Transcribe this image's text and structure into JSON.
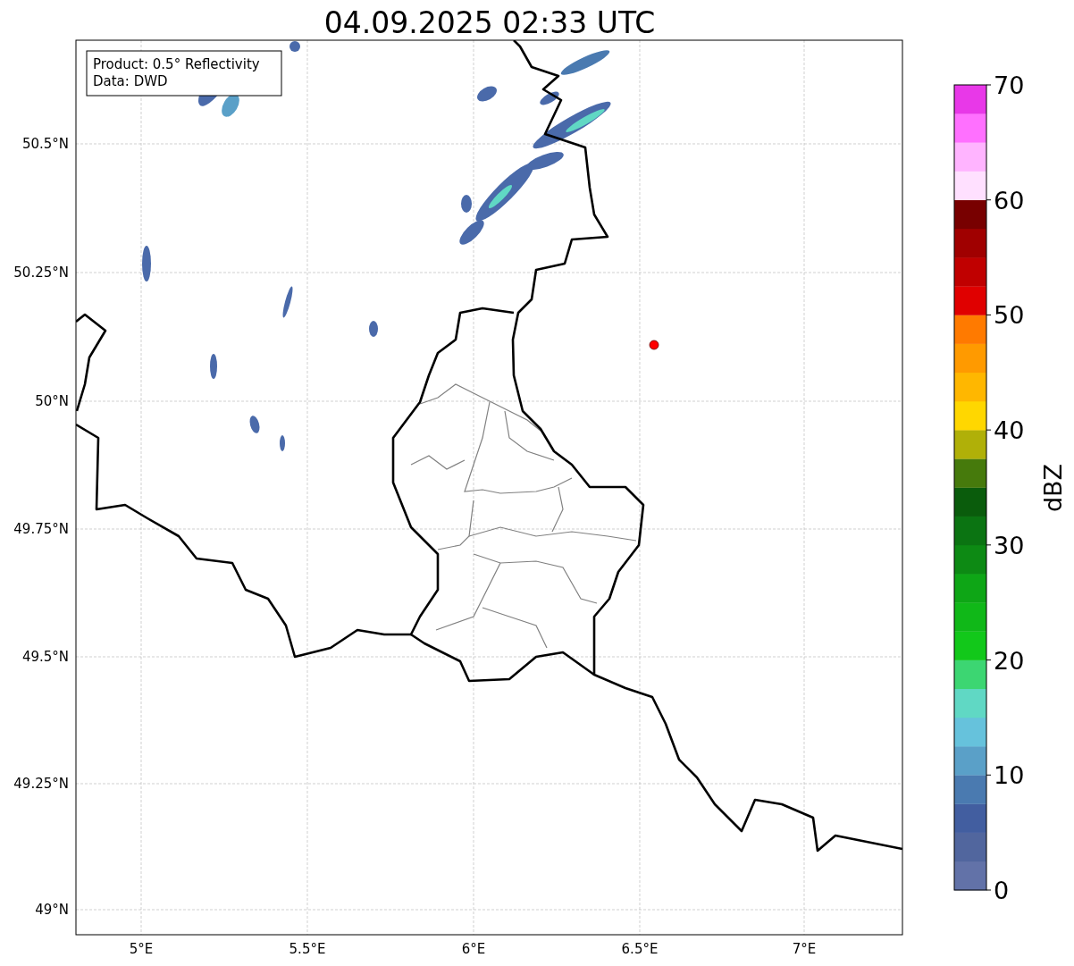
{
  "title": "04.09.2025 02:33 UTC",
  "info_box": {
    "lines": [
      "Product: 0.5° Reflectivity",
      "Data: DWD"
    ]
  },
  "map": {
    "lat_labels": [
      "50.5°N",
      "50.25°N",
      "50°N",
      "49.75°N",
      "49.5°N",
      "49.25°N",
      "49°N"
    ],
    "lon_labels": [
      "5°E",
      "5.5°E",
      "6°E",
      "6.5°E",
      "7°E"
    ]
  },
  "colorbar": {
    "label": "dBZ",
    "tick_labels": [
      "70",
      "60",
      "50",
      "40",
      "30",
      "20",
      "10",
      "0"
    ],
    "segments": [
      {
        "color": "#6272a8"
      },
      {
        "color": "#51669e"
      },
      {
        "color": "#425ea0"
      },
      {
        "color": "#4a7ab0"
      },
      {
        "color": "#5aa0c8"
      },
      {
        "color": "#66c2dc"
      },
      {
        "color": "#60d8c4"
      },
      {
        "color": "#3cd672"
      },
      {
        "color": "#12c81a"
      },
      {
        "color": "#10b818"
      },
      {
        "color": "#0ea616"
      },
      {
        "color": "#0d8a14"
      },
      {
        "color": "#0b7412"
      },
      {
        "color": "#0a5c0c"
      },
      {
        "color": "#467a0c"
      },
      {
        "color": "#b0b008"
      },
      {
        "color": "#ffd700"
      },
      {
        "color": "#ffb700"
      },
      {
        "color": "#ff9a00"
      },
      {
        "color": "#ff7a00"
      },
      {
        "color": "#e00000"
      },
      {
        "color": "#c00000"
      },
      {
        "color": "#a00000"
      },
      {
        "color": "#780000"
      },
      {
        "color": "#ffe0ff"
      },
      {
        "color": "#ffb4ff"
      },
      {
        "color": "#ff70ff"
      },
      {
        "color": "#e838e8"
      }
    ]
  }
}
